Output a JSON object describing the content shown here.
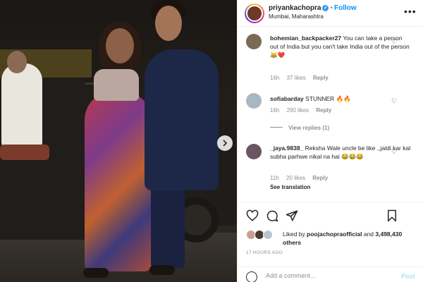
{
  "post": {
    "username": "priyankachopra",
    "follow_label": "Follow",
    "location": "Mumbai, Maharashtra",
    "more_label": "•••",
    "verified_glyph": "✓"
  },
  "comments": [
    {
      "username": "bohemian_backpacker27",
      "text": "You can take a person out of India but you can't take India out of the person 😹❤️",
      "time": "16h",
      "likes": "37 likes",
      "reply_label": "Reply",
      "avatar_color": "#7a6a55"
    },
    {
      "username": "sofiabarday",
      "text": "STUNNER 🔥🔥",
      "time": "16h",
      "likes": "290 likes",
      "reply_label": "Reply",
      "view_replies": "View replies (1)",
      "avatar_color": "#a9b7c2"
    },
    {
      "username": "_jaya.9838_",
      "text": "Reksha Wale uncle be like ,,jaldi kar kal subha parhwe nikal na hai 😂😂😂",
      "time": "11h",
      "likes": "20 likes",
      "reply_label": "Reply",
      "see_translation": "See translation",
      "avatar_color": "#6a5560"
    }
  ],
  "likes": {
    "prefix": "Liked by",
    "user": "poojachopraofficial",
    "conjunction": "and",
    "others": "3,498,430 others"
  },
  "timestamp": "17 HOURS AGO",
  "add_comment": {
    "placeholder": "Add a comment...",
    "post_label": "Post"
  },
  "icons": {
    "heart": "heart-icon",
    "comment": "comment-icon",
    "share": "share-icon",
    "save": "bookmark-icon",
    "emoji": "emoji-icon",
    "next": "chevron-right-icon"
  },
  "colors": {
    "accent": "#0095f6",
    "verified": "#3897f0",
    "muted": "#8e8e8e"
  }
}
